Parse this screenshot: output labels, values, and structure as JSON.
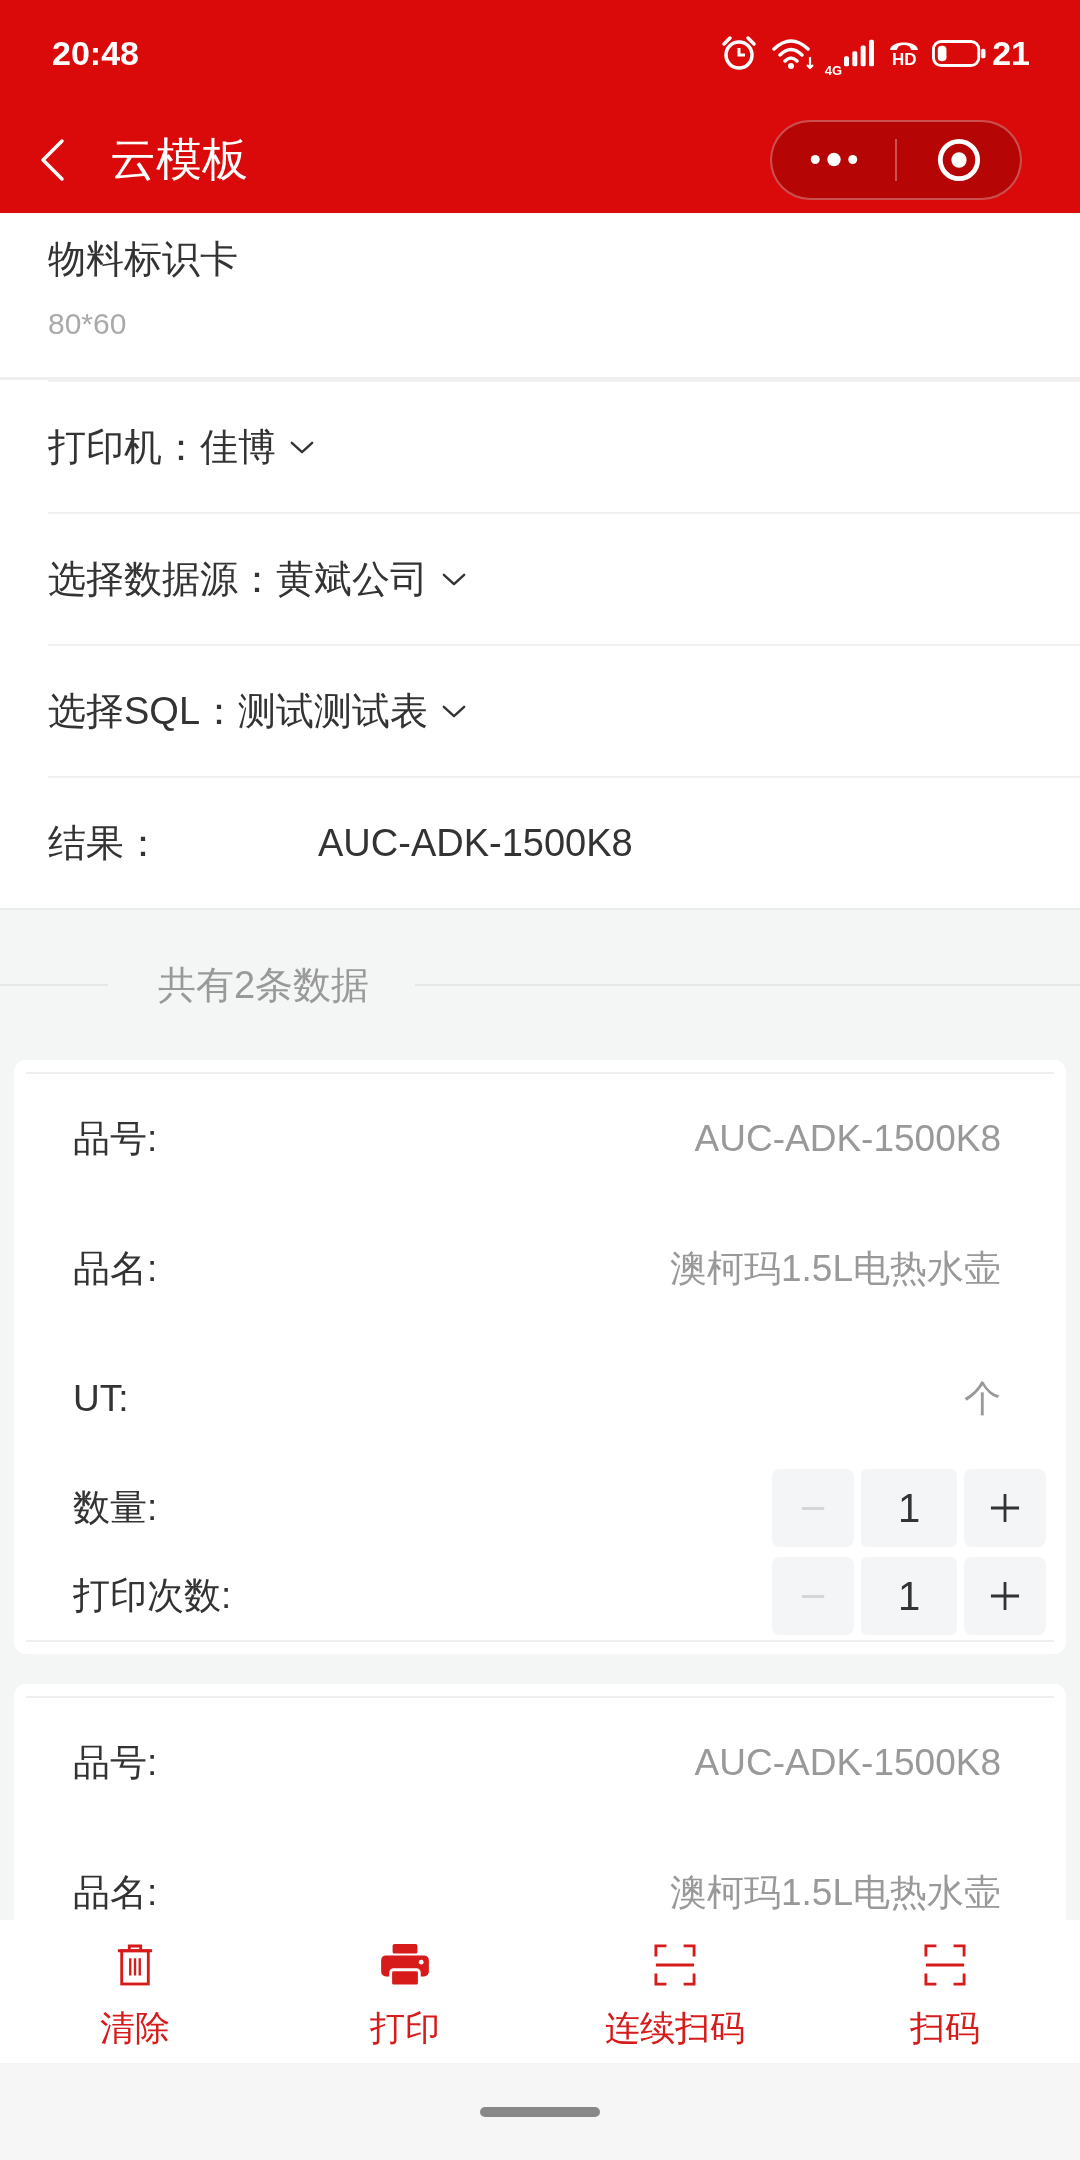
{
  "status_bar": {
    "time": "20:48",
    "network_type": "4G",
    "call_badge": "HD",
    "battery": "21"
  },
  "nav_bar": {
    "title": "云模板"
  },
  "template": {
    "name": "物料标识卡",
    "size": "80*60"
  },
  "settings": [
    {
      "kind": "dropdown",
      "label": "打印机：",
      "value": "佳博"
    },
    {
      "kind": "dropdown",
      "label": "选择数据源：",
      "value": "黄斌公司"
    },
    {
      "kind": "dropdown",
      "label": "选择SQL：",
      "value": "测试测试表"
    },
    {
      "kind": "text",
      "label": "结果：",
      "value": "AUC-ADK-1500K8"
    }
  ],
  "summary": "共有2条数据",
  "records": [
    {
      "fields": [
        {
          "kind": "text",
          "label": "品号:",
          "value": "AUC-ADK-1500K8"
        },
        {
          "kind": "text",
          "label": "品名:",
          "value": "澳柯玛1.5L电热水壶"
        },
        {
          "kind": "text",
          "label": "UT:",
          "value": "个"
        },
        {
          "kind": "stepper",
          "label": "数量:",
          "value": "1",
          "decrease_disabled": true
        },
        {
          "kind": "stepper",
          "label": "打印次数:",
          "value": "1",
          "decrease_disabled": true
        }
      ]
    },
    {
      "fields": [
        {
          "kind": "text",
          "label": "品号:",
          "value": "AUC-ADK-1500K8"
        },
        {
          "kind": "text",
          "label": "品名:",
          "value": "澳柯玛1.5L电热水壶"
        }
      ]
    }
  ],
  "toolbar": [
    {
      "kind": "clear",
      "label": "清除"
    },
    {
      "kind": "print",
      "label": "打印"
    },
    {
      "kind": "scan",
      "label": "连续扫码"
    },
    {
      "kind": "scan",
      "label": "扫码"
    }
  ]
}
